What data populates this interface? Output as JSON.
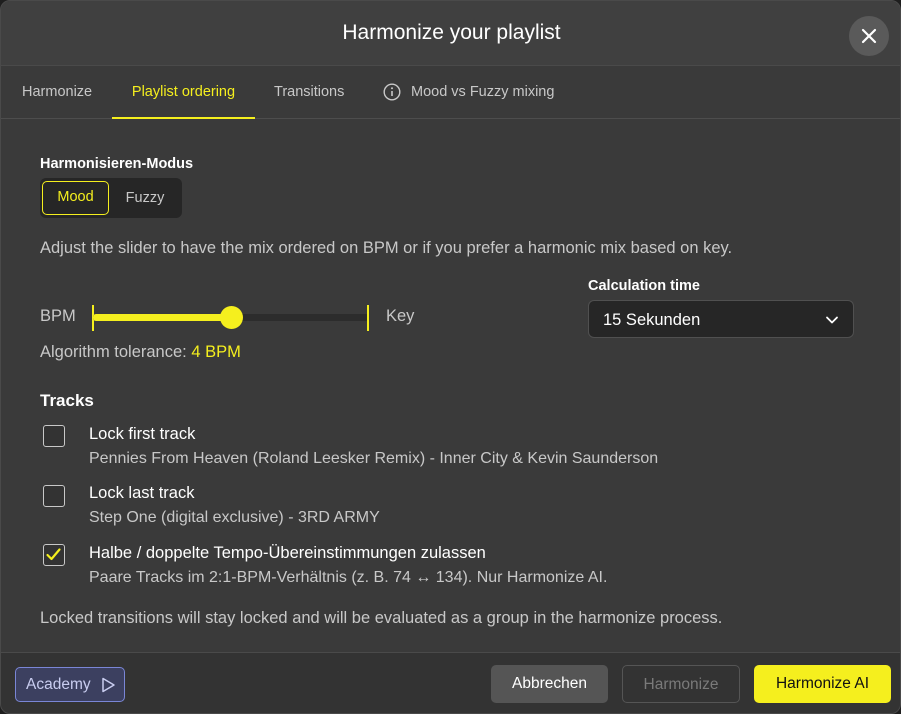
{
  "dialog": {
    "title": "Harmonize your playlist"
  },
  "tabs": [
    {
      "label": "Harmonize",
      "active": false
    },
    {
      "label": "Playlist ordering",
      "active": true
    },
    {
      "label": "Transitions",
      "active": false
    },
    {
      "label": "Mood vs Fuzzy mixing",
      "active": false,
      "icon": "info-icon"
    }
  ],
  "mode": {
    "label": "Harmonisieren-Modus",
    "options": [
      "Mood",
      "Fuzzy"
    ],
    "selected": "Mood"
  },
  "description": "Adjust the slider to have the mix ordered on BPM or if you prefer a harmonic mix based on key.",
  "slider": {
    "left_label": "BPM",
    "right_label": "Key",
    "value_fraction": 0.5,
    "tolerance_label": "Algorithm tolerance:",
    "tolerance_value": "4 BPM"
  },
  "calculation": {
    "label": "Calculation time",
    "value": "15 Sekunden"
  },
  "tracks": {
    "heading": "Tracks",
    "items": [
      {
        "title": "Lock first track",
        "subtitle": "Pennies From Heaven (Roland Leesker Remix) - Inner City & Kevin Saunderson",
        "checked": false
      },
      {
        "title": "Lock last track",
        "subtitle": "Step One (digital exclusive) - 3RD ARMY",
        "checked": false
      },
      {
        "title": "Halbe / doppelte Tempo-Übereinstimmungen zulassen",
        "subtitle": "Paare Tracks im 2:1-BPM-Verhältnis (z. B. 74 ↔ 134). Nur Harmonize AI.",
        "checked": true
      }
    ]
  },
  "note": "Locked transitions will stay locked and will be evaluated as a group in the harmonize process.",
  "footer": {
    "academy": "Academy",
    "cancel": "Abbrechen",
    "harmonize": "Harmonize",
    "harmonize_ai": "Harmonize AI"
  },
  "colors": {
    "accent": "#f5ef1e",
    "background": "#3a3a3a",
    "academy_border": "#7a86d6"
  }
}
